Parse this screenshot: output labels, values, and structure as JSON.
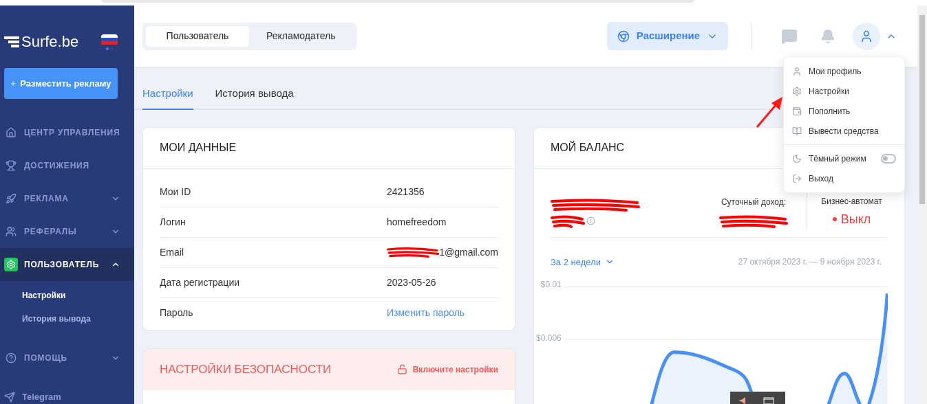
{
  "sidebar": {
    "logo": "Surfe.be",
    "cta": "Разместить рекламу",
    "cta_icon": "+",
    "items": [
      {
        "label": "ЦЕНТР УПРАВЛЕНИЯ",
        "selected": false
      },
      {
        "label": "ДОСТИЖЕНИЯ",
        "selected": false
      },
      {
        "label": "РЕКЛАМА",
        "expanded": false,
        "has_children": true,
        "selected": false
      },
      {
        "label": "РЕФЕРАЛЫ",
        "expanded": false,
        "has_children": true,
        "selected": false
      },
      {
        "label": "ПОЛЬЗОВАТЕЛЬ",
        "expanded": true,
        "has_children": true,
        "selected": true,
        "children": [
          {
            "label": "Настройки",
            "selected": true
          },
          {
            "label": "История вывода",
            "selected": false
          }
        ]
      },
      {
        "label": "ПОМОЩЬ",
        "expanded": false,
        "has_children": true,
        "selected": false
      }
    ],
    "footer_link": "Telegram"
  },
  "header": {
    "modes": [
      {
        "label": "Пользователь",
        "selected": true
      },
      {
        "label": "Рекламодатель",
        "selected": false
      }
    ],
    "extension_button": "Расширение",
    "menu_open": true
  },
  "tabs": [
    {
      "label": "Настройки",
      "selected": true
    },
    {
      "label": "История вывода",
      "selected": false
    }
  ],
  "my_data": {
    "title": "МОИ ДАННЫЕ",
    "rows": [
      {
        "label": "Мои ID",
        "value": "2421356",
        "kind": "text"
      },
      {
        "label": "Логин",
        "value": "homefreedom",
        "kind": "text"
      },
      {
        "label": "Email",
        "value": "1@gmail.com",
        "kind": "redacted"
      },
      {
        "label": "Дата регистрации",
        "value": "2023-05-26",
        "kind": "text"
      },
      {
        "label": "Пароль",
        "value": "Изменить пароль",
        "kind": "link"
      }
    ]
  },
  "security": {
    "title": "НАСТРОЙКИ БЕЗОПАСНОСТИ",
    "action": "Включите настройки"
  },
  "balance": {
    "title": "МОЙ БАЛАНС",
    "daily_label": "Суточный доход:",
    "automat_label": "Бизнес-автомат",
    "automat_status": "Выкл",
    "automat_on": false,
    "period": "За 2 недели",
    "date_range": "27 октября 2023 г. — 9 ноября 2023 г.",
    "chart": {
      "y_tick_labels": [
        "$0.01",
        "$0.006"
      ]
    }
  },
  "user_menu": {
    "items": [
      {
        "label": "Мои профиль",
        "kind": "link"
      },
      {
        "label": "Настройки",
        "kind": "link"
      },
      {
        "label": "Пополнить",
        "kind": "link"
      },
      {
        "label": "Вывести средства",
        "kind": "link"
      },
      {
        "label": "Тёмный режим",
        "kind": "toggle",
        "on": false
      },
      {
        "label": "Выход",
        "kind": "link"
      }
    ]
  }
}
